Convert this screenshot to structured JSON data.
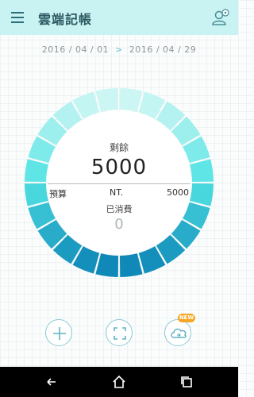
{
  "app": {
    "title": "雲端記帳"
  },
  "header": {
    "menu_icon": "menu-icon",
    "user_icon": "user-settings-icon"
  },
  "date_range": {
    "start": "2016 / 04 / 01",
    "separator": ">",
    "end": "2016 / 04 / 29"
  },
  "summary": {
    "remaining_label": "剩餘",
    "remaining_value": "5000",
    "budget_label": "預算",
    "currency": "NT.",
    "budget_value": "5000",
    "spent_label": "已消費",
    "spent_value": "0",
    "remaining_fraction": 1.0
  },
  "actions": [
    {
      "name": "add-button",
      "icon": "plus-icon"
    },
    {
      "name": "scan-button",
      "icon": "scan-frame-icon"
    },
    {
      "name": "cloud-sync-button",
      "icon": "cloud-icon",
      "badge": "NEW"
    }
  ],
  "system_nav": [
    "back-icon",
    "home-icon",
    "recent-apps-icon"
  ],
  "colors": {
    "header_bg": "#c9f3f3",
    "ring_top": "#cdf6f4",
    "ring_mid": "#4fe3e3",
    "ring_bottom": "#0f88b8",
    "badge": "#f5a623"
  }
}
